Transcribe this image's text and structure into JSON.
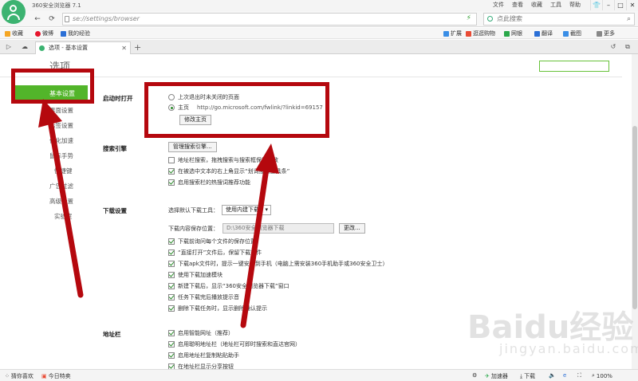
{
  "titlebar": {
    "app_title": "360安全浏览器 7.1",
    "menus": [
      "文件",
      "查看",
      "收藏",
      "工具",
      "帮助"
    ],
    "window_buttons": [
      "shirt-icon",
      "minimize-icon",
      "maximize-icon",
      "close-icon"
    ]
  },
  "address_bar": {
    "url": "se://settings/browser",
    "search_placeholder": "点此搜索"
  },
  "bookmarks": {
    "items": [
      "收藏",
      "微博",
      "我的经验"
    ],
    "right_items": [
      "扩展",
      "逛逛购物",
      "网银",
      "翻译",
      "截图",
      "更多"
    ]
  },
  "tabs": [
    {
      "label": "选项 - 基本设置"
    }
  ],
  "page": {
    "title": "选项"
  },
  "sidebar": {
    "active": "基本设置",
    "items": [
      "界面设置",
      "标签设置",
      "优化加速",
      "鼠标手势",
      "快捷键",
      "广告过滤",
      "高级设置",
      "实验室"
    ]
  },
  "sections": {
    "startup": {
      "label": "启动时打开",
      "opt1": "上次退出时未关闭的页面",
      "opt2": "主页",
      "homepage_url": "http://go.microsoft.com/fwlink/?linkid=69157",
      "button": "修改主页"
    },
    "search": {
      "label": "搜索引擎",
      "button": "管理搜索引擎...",
      "items": [
        {
          "text": "地址栏搜索，拖拽搜索与搜索框保持一致",
          "checked": false
        },
        {
          "text": "在被选中文本的右上角显示“划词搜索工具条”",
          "checked": true
        },
        {
          "text": "启用搜索栏的热搜词推荐功能",
          "checked": true
        }
      ]
    },
    "download": {
      "label": "下载设置",
      "tool_label": "选择默认下载工具：",
      "tool_value": "使用内建下载",
      "path_label": "下载内容保存位置：",
      "path_value": "D:\\360安全浏览器下载",
      "change_button": "更改...",
      "items": [
        {
          "text": "下载前询问每个文件的保存位置",
          "checked": true
        },
        {
          "text": "“直接打开”文件后，保留下载文件",
          "checked": true
        },
        {
          "text": "下载apk文件时，提示一键安装到手机（电脑上需安装360手机助手或360安全卫士）",
          "checked": true
        },
        {
          "text": "使用下载加速模块",
          "checked": true
        },
        {
          "text": "新建下载后，显示“360安全浏览器下载”窗口",
          "checked": true
        },
        {
          "text": "任务下载完后播放提示音",
          "checked": true
        },
        {
          "text": "删除下载任务时，显示删除确认提示",
          "checked": true
        }
      ]
    },
    "address": {
      "label": "地址栏",
      "items": [
        {
          "text": "启用智能网址（推荐）",
          "checked": true
        },
        {
          "text": "启用聪明地址栏（地址栏可即时搜索和直达官网）",
          "checked": true
        },
        {
          "text": "启用地址栏复制粘贴助手",
          "checked": true
        },
        {
          "text": "在地址栏显示分享按钮",
          "checked": true
        }
      ]
    }
  },
  "statusbar": {
    "left": [
      "猜你喜欢",
      "今日特卖"
    ],
    "right": [
      "加速器",
      "下载",
      "100%"
    ]
  },
  "watermark": {
    "brand": "Baidu经验",
    "sub": "jingyan.baidu.com"
  },
  "colors": {
    "accent_green": "#52b52a",
    "highlight_red": "#b5080e"
  }
}
